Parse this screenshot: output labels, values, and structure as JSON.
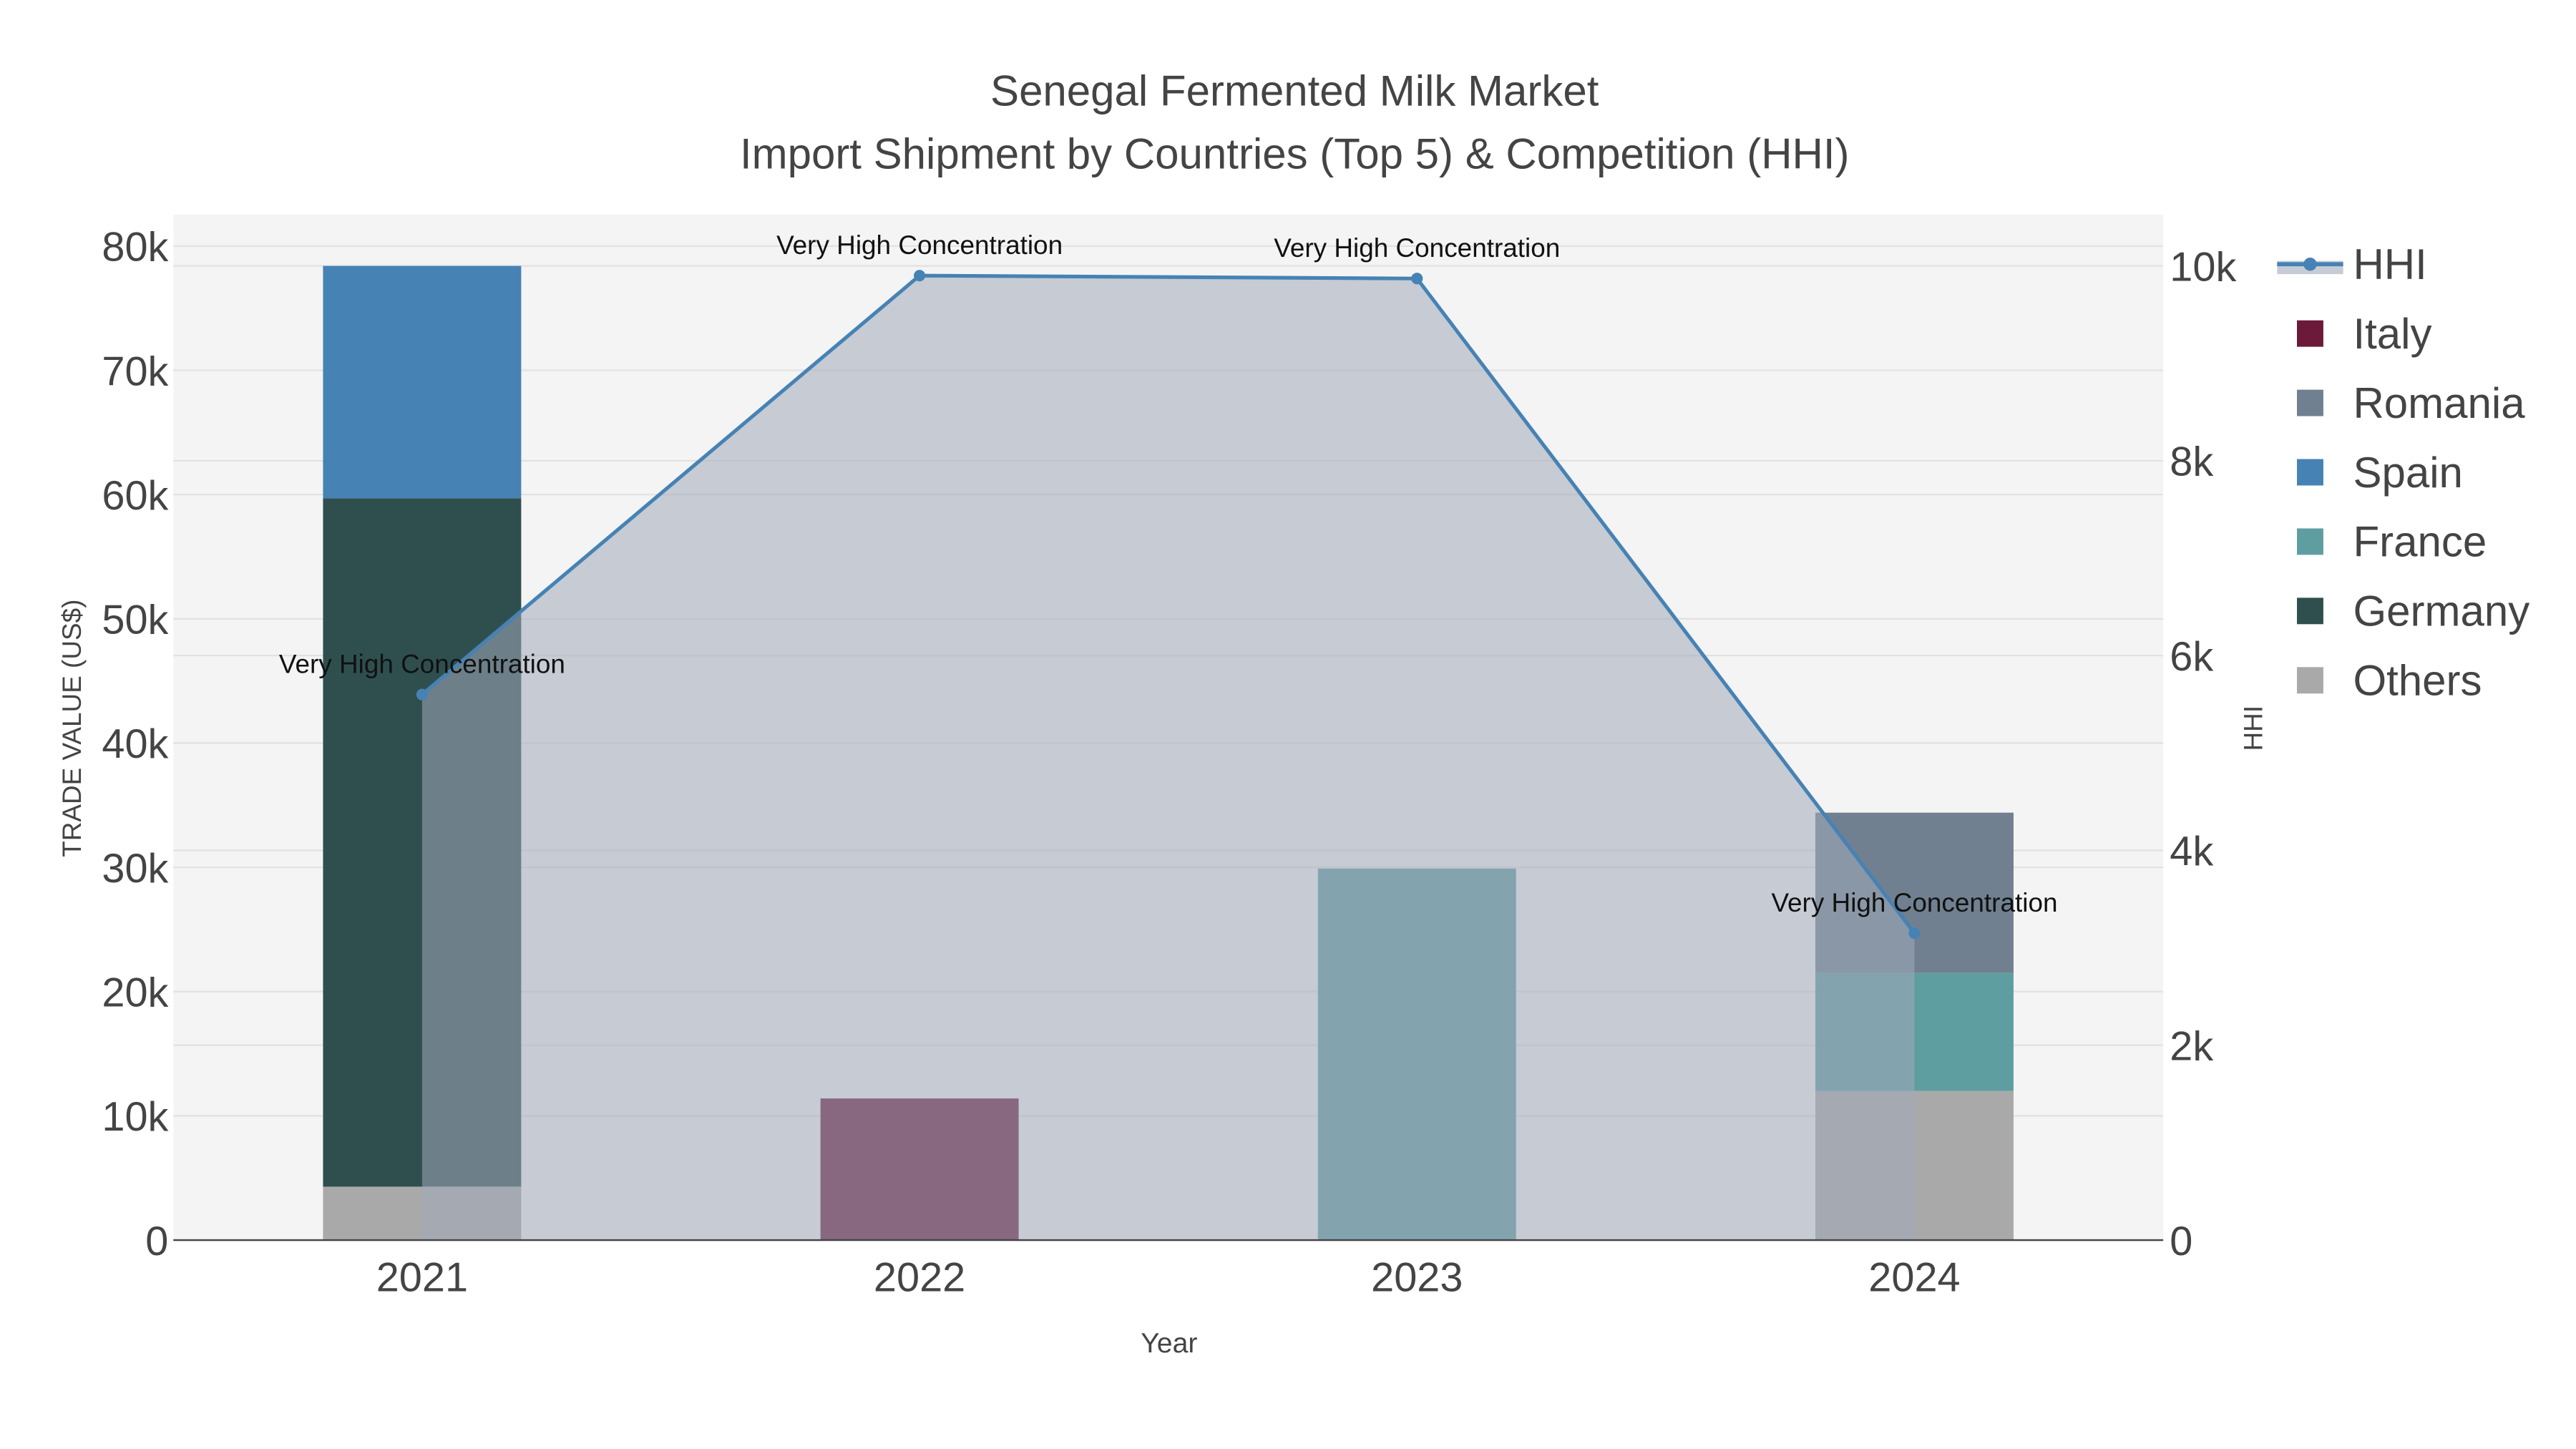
{
  "chart_data": {
    "type": "bar",
    "title_line1": "Senegal Fermented Milk Market",
    "title_line2": "Import Shipment by Countries (Top 5) & Competition (HHI)",
    "xlabel": "Year",
    "ylabel": "TRADE VALUE (US$)",
    "y2label": "HHI",
    "categories": [
      "2021",
      "2022",
      "2023",
      "2024"
    ],
    "ylim": [
      0,
      82000
    ],
    "y2lim": [
      0,
      10500
    ],
    "yticks": [
      0,
      10000,
      20000,
      30000,
      40000,
      50000,
      60000,
      70000,
      80000
    ],
    "ytick_labels": [
      "0",
      "10k",
      "20k",
      "30k",
      "40k",
      "50k",
      "60k",
      "70k",
      "80k"
    ],
    "y2ticks": [
      0,
      2000,
      4000,
      6000,
      8000,
      10000
    ],
    "y2tick_labels": [
      "0",
      "2k",
      "4k",
      "6k",
      "8k",
      "10k"
    ],
    "series": [
      {
        "name": "Others",
        "color": "#a9a9a9",
        "values": [
          4300,
          0,
          0,
          12000
        ]
      },
      {
        "name": "Germany",
        "color": "#2f4f4f",
        "values": [
          55400,
          0,
          0,
          0
        ]
      },
      {
        "name": "France",
        "color": "#5f9ea0",
        "values": [
          0,
          0,
          29900,
          9500
        ]
      },
      {
        "name": "Spain",
        "color": "#4682b4",
        "values": [
          18700,
          0,
          0,
          0
        ]
      },
      {
        "name": "Romania",
        "color": "#708090",
        "values": [
          0,
          0,
          0,
          12900
        ]
      },
      {
        "name": "Italy",
        "color": "#6b1a3a",
        "values": [
          0,
          11400,
          0,
          0
        ]
      }
    ],
    "hhi": {
      "name": "HHI",
      "color": "#4682b4",
      "values": [
        5600,
        9900,
        9870,
        3150
      ],
      "annotations": [
        "Very High Concentration",
        "Very High Concentration",
        "Very High Concentration",
        "Very High Concentration"
      ]
    },
    "legend_order": [
      "HHI",
      "Italy",
      "Romania",
      "Spain",
      "France",
      "Germany",
      "Others"
    ],
    "legend_placement": "right",
    "grid": true
  }
}
